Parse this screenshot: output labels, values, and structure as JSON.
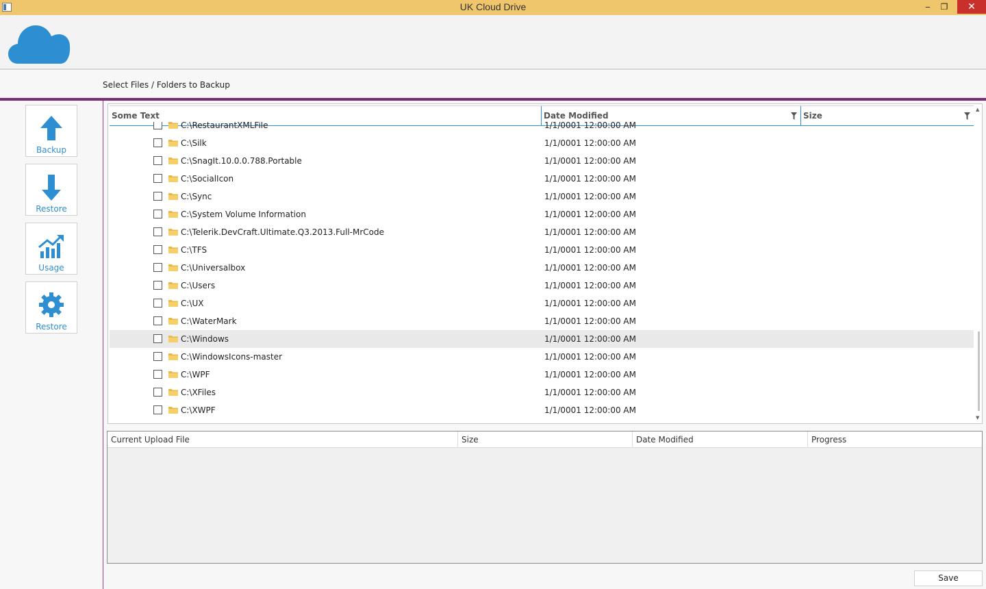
{
  "window": {
    "title": "UK Cloud Drive",
    "minimize_glyph": "‒",
    "maximize_glyph": "❐",
    "close_glyph": "✕"
  },
  "header": {
    "logo_icon": "cloud-icon",
    "section_title": "Select Files / Folders to Backup"
  },
  "sidebar": {
    "items": [
      {
        "label": "Backup",
        "icon": "arrow-up-icon"
      },
      {
        "label": "Restore",
        "icon": "arrow-down-icon"
      },
      {
        "label": "Usage",
        "icon": "chart-icon"
      },
      {
        "label": "Restore",
        "icon": "gear-icon"
      }
    ]
  },
  "tree": {
    "columns": [
      "Some Text",
      "Date Modified",
      "Size"
    ],
    "rows": [
      {
        "name": "C:\\RestaurantXMLFile",
        "date": "1/1/0001 12:00:00 AM"
      },
      {
        "name": "C:\\Silk",
        "date": "1/1/0001 12:00:00 AM"
      },
      {
        "name": "C:\\SnagIt.10.0.0.788.Portable",
        "date": "1/1/0001 12:00:00 AM"
      },
      {
        "name": "C:\\SocialIcon",
        "date": "1/1/0001 12:00:00 AM"
      },
      {
        "name": "C:\\Sync",
        "date": "1/1/0001 12:00:00 AM"
      },
      {
        "name": "C:\\System Volume Information",
        "date": "1/1/0001 12:00:00 AM"
      },
      {
        "name": "C:\\Telerik.DevCraft.Ultimate.Q3.2013.Full-MrCode",
        "date": "1/1/0001 12:00:00 AM"
      },
      {
        "name": "C:\\TFS",
        "date": "1/1/0001 12:00:00 AM"
      },
      {
        "name": "C:\\Universalbox",
        "date": "1/1/0001 12:00:00 AM"
      },
      {
        "name": "C:\\Users",
        "date": "1/1/0001 12:00:00 AM"
      },
      {
        "name": "C:\\UX",
        "date": "1/1/0001 12:00:00 AM"
      },
      {
        "name": "C:\\WaterMark",
        "date": "1/1/0001 12:00:00 AM"
      },
      {
        "name": "C:\\Windows",
        "date": "1/1/0001 12:00:00 AM",
        "selected": true
      },
      {
        "name": "C:\\WindowsIcons-master",
        "date": "1/1/0001 12:00:00 AM"
      },
      {
        "name": "C:\\WPF",
        "date": "1/1/0001 12:00:00 AM"
      },
      {
        "name": "C:\\XFiles",
        "date": "1/1/0001 12:00:00 AM"
      },
      {
        "name": "C:\\XWPF",
        "date": "1/1/0001 12:00:00 AM"
      }
    ]
  },
  "upload": {
    "columns": [
      "Current Upload File",
      "Size",
      "Date Modified",
      "Progress"
    ]
  },
  "footer": {
    "save_label": "Save"
  },
  "colors": {
    "titlebar": "#f0c66c",
    "accent": "#7b2d73",
    "icon_blue": "#2d8fd1",
    "close_red": "#c9302c"
  }
}
